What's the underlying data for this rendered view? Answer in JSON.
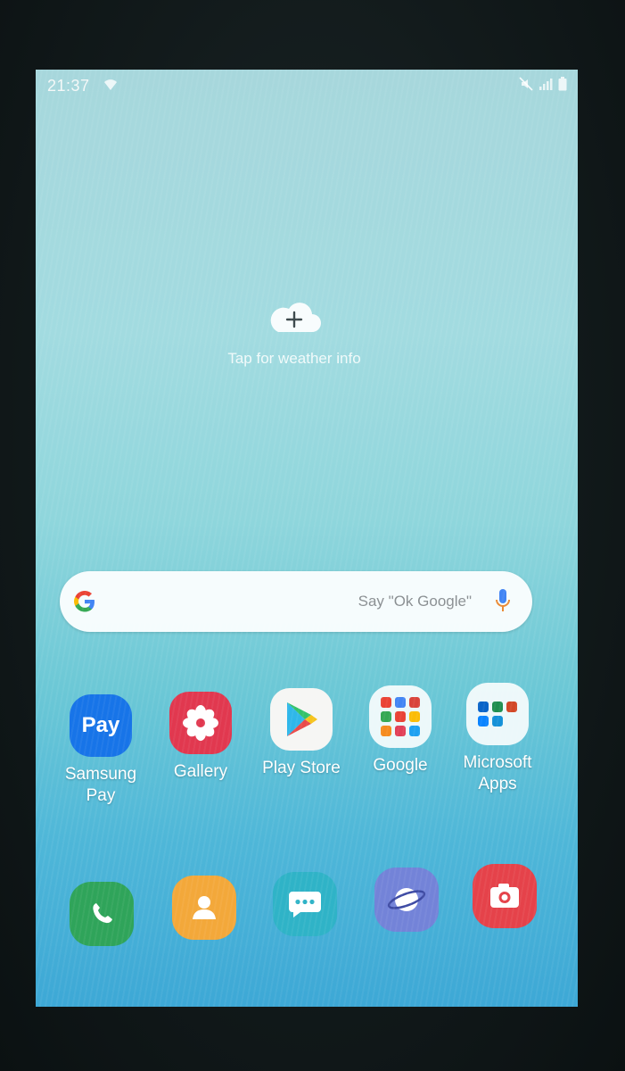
{
  "status_bar": {
    "time": "21:37",
    "left_icons": [
      "wifi-icon"
    ],
    "right_icons": [
      "mute-icon",
      "signal-icon",
      "battery-icon"
    ]
  },
  "weather": {
    "prompt": "Tap for weather info",
    "icon": "cloud-plus-icon"
  },
  "search": {
    "placeholder": "Say \"Ok Google\"",
    "logo": "google-g-icon",
    "mic": "mic-icon"
  },
  "apps": [
    {
      "label": "Samsung\nPay",
      "icon": "samsung-pay-icon",
      "icon_text": "Pay",
      "color": "#1774e8"
    },
    {
      "label": "Gallery",
      "icon": "gallery-icon",
      "color": "#e1384f"
    },
    {
      "label": "Play Store",
      "icon": "play-store-icon",
      "color": "#f6f6f4"
    },
    {
      "label": "Google",
      "icon": "google-folder-icon",
      "color": "#ffffff"
    },
    {
      "label": "Microsoft\nApps",
      "icon": "microsoft-folder-icon",
      "color": "#ffffff"
    }
  ],
  "dock": [
    {
      "icon": "phone-icon",
      "color": "#2fa45a"
    },
    {
      "icon": "contacts-icon",
      "color": "#f3a83a"
    },
    {
      "icon": "messages-icon",
      "color": "#2fb3c7"
    },
    {
      "icon": "internet-icon",
      "color": "#7383d8"
    },
    {
      "icon": "camera-icon",
      "color": "#e5424a"
    }
  ]
}
